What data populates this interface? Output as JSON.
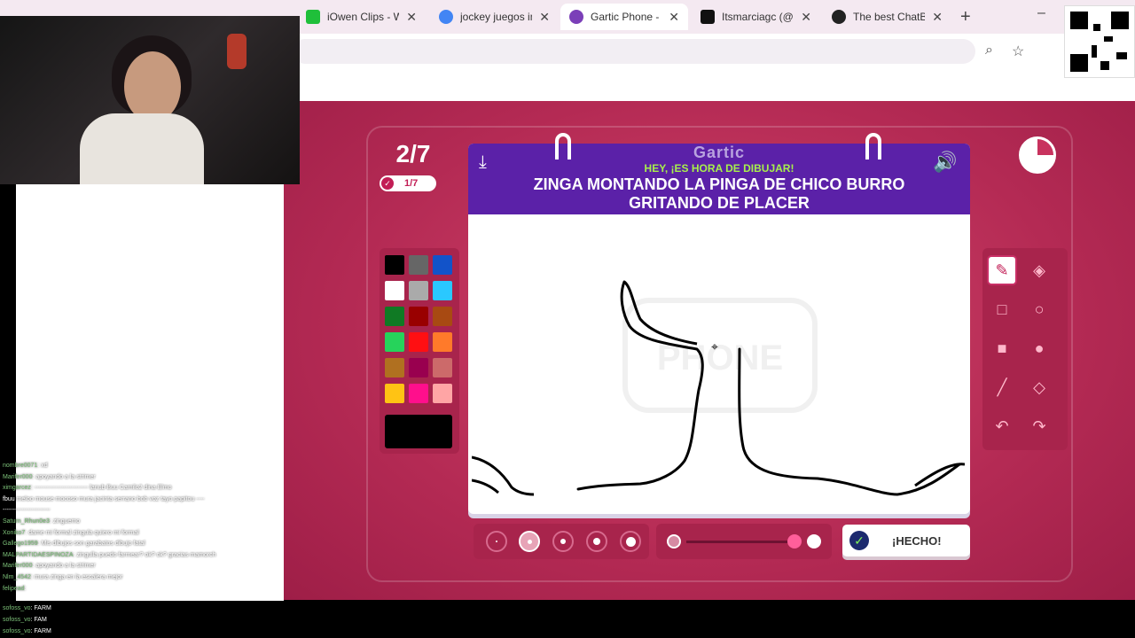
{
  "browser": {
    "tabs": [
      {
        "title": "iOwen Clips - W",
        "color": "#1fbf3a"
      },
      {
        "title": "jockey juegos in",
        "color": "#4285f4"
      },
      {
        "title": "Gartic Phone - T",
        "color": "#7b3fb8",
        "active": true
      },
      {
        "title": "Itsmarciagc (@it",
        "color": "#111111"
      },
      {
        "title": "The best ChatBo",
        "color": "#222222"
      }
    ],
    "new_tab": "+",
    "minimize": "–",
    "close_glyph": "✕"
  },
  "game": {
    "round": "2/7",
    "done_count": "1/7",
    "brand": "Gartic",
    "hey": "HEY, ¡ES HORA DE DIBUJAR!",
    "prompt": "ZINGA MONTANDO LA PINGA DE CHICO BURRO GRITANDO DE PLACER",
    "watermark": "PHONE",
    "done_button": "¡HECHO!"
  },
  "palette": {
    "colors": [
      "#000000",
      "#666666",
      "#1253c9",
      "#ffffff",
      "#aaaaaa",
      "#2ac8ff",
      "#107a24",
      "#990000",
      "#a84a12",
      "#26d35b",
      "#ff0f12",
      "#ff7a2a",
      "#b07020",
      "#99004f",
      "#cc6a6a",
      "#ffc314",
      "#ff0f8c",
      "#ffa5a5"
    ],
    "current": "#000000"
  },
  "tools": [
    "pencil",
    "eraser",
    "rect-outline",
    "circle-outline",
    "rect-fill",
    "circle-fill",
    "line",
    "bucket",
    "undo",
    "redo"
  ],
  "chat": [
    {
      "u": "nombre0071",
      "t": ": xd"
    },
    {
      "u": "Marifer000",
      "t": ": apoyando a la strimer"
    },
    {
      "u": "ximgarcez",
      "t": ": -------------------------- lanub Buu Camilo2 dina Elmo"
    },
    {
      "u": "",
      "t": "fbuu meloo mouse mocoso mura jacinta serrano bob voz tayo papitou ----"
    },
    {
      "u": "",
      "t": "-----------------------"
    },
    {
      "u": "Saturn_Rhun0e3",
      "t": ": zinguemo"
    },
    {
      "u": "Xoniko7",
      "t": ": dame mi formal zingula quiero mi formal"
    },
    {
      "u": "Gallego1959",
      "t": ": Mis dibujos son garabatos dibujo fatal"
    },
    {
      "u": "MALPARTIDAESPINOZA",
      "t": ": zingulla puedo farmear? ok? ok? gracias mamorch"
    },
    {
      "u": "Marifer000",
      "t": ": apoyando a la strimer"
    },
    {
      "u": "Nlm_4542",
      "t": ": mura zinga en la escalera mejor"
    },
    {
      "u": "felipead",
      "t": ":"
    }
  ],
  "chat_bottom": [
    {
      "u": "sofoss_vo",
      "t": ": FARM"
    },
    {
      "u": "sofoss_vo",
      "t": ": FAM"
    },
    {
      "u": "sofoss_vo",
      "t": ": FARM"
    }
  ]
}
